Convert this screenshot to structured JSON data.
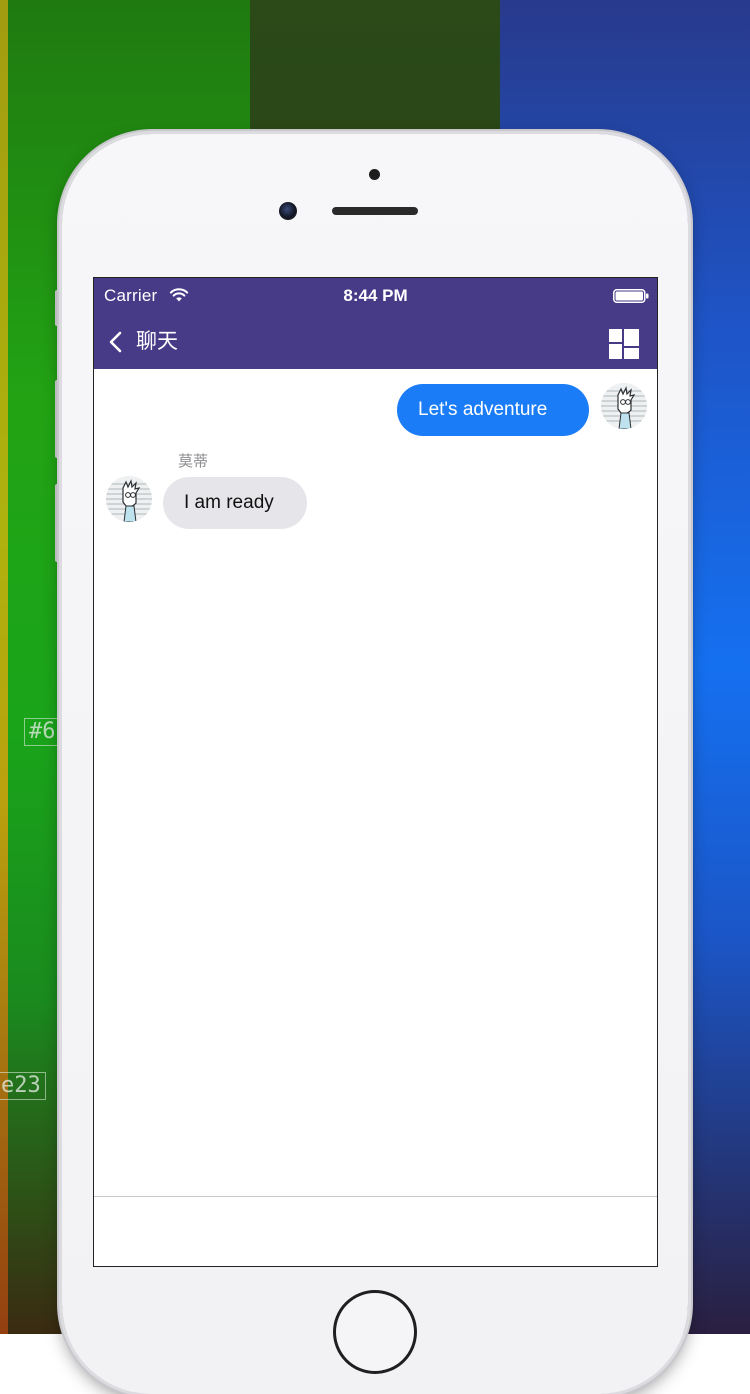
{
  "background": {
    "hex_label_top": "#6",
    "hex_label_bottom": "e23",
    "colors": {
      "green": "#22a314",
      "dark_green": "#263f16",
      "blue": "#1570f0"
    }
  },
  "status_bar": {
    "carrier": "Carrier",
    "time": "8:44 PM",
    "icons": [
      "wifi-icon",
      "battery-icon"
    ]
  },
  "nav": {
    "back_icon": "chevron-left-icon",
    "title": "聊天",
    "action_icon": "layout-grid-icon",
    "bar_color": "#473b88"
  },
  "messages": [
    {
      "direction": "outgoing",
      "text": "Let's adventure",
      "bubble_color": "#1a7cf6"
    },
    {
      "direction": "incoming",
      "sender": "莫蒂",
      "text": "I am ready",
      "bubble_color": "#e6e6ea"
    }
  ],
  "composer": {
    "placeholder": ""
  }
}
